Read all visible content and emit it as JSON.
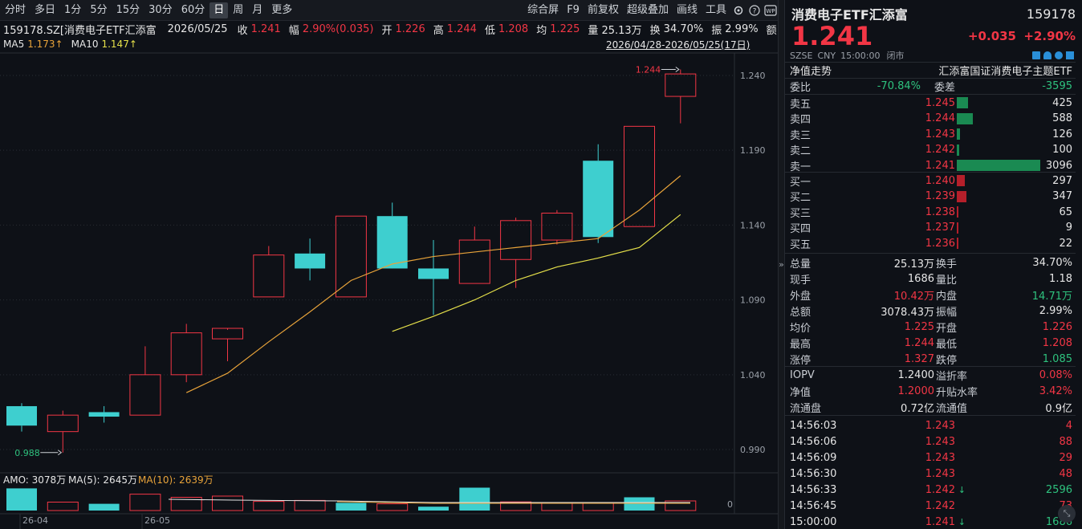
{
  "toolbar": {
    "periods": [
      "分时",
      "多日",
      "1分",
      "5分",
      "15分",
      "30分",
      "60分",
      "日",
      "周",
      "月",
      "更多"
    ],
    "active_period": "日",
    "right_buttons": [
      "综合屏",
      "F9",
      "前复权",
      "超级叠加",
      "画线",
      "工具"
    ],
    "icons": [
      "gear-icon",
      "help-icon",
      "wp-icon"
    ]
  },
  "info": {
    "code": "159178.SZ[消费电子ETF汇添富",
    "date": "2026/05/25",
    "close_label": "收",
    "close": "1.241",
    "chg_label": "幅",
    "chg": "2.90%(0.035)",
    "open_label": "开",
    "open": "1.226",
    "high_label": "高",
    "high": "1.244",
    "low_label": "低",
    "low": "1.208",
    "avg_label": "均",
    "avg": "1.225",
    "vol_label": "量",
    "vol": "25.13万",
    "turn_label": "换",
    "turn": "34.70%",
    "amp_label": "振",
    "amp": "2.99%",
    "amt_label": "额"
  },
  "ma": {
    "ma5_label": "MA5",
    "ma5": "1.173↑",
    "ma10_label": "MA10",
    "ma10": "1.147↑",
    "range": "2026/04/28-2026/05/25(17日)"
  },
  "volume_legend": {
    "amo": "AMO: 3078万",
    "ma5": "MA(5): 2645万",
    "ma10": "MA(10): 2639万",
    "zero": "0"
  },
  "colors": {
    "up": "#f23645",
    "down": "#2ec27e",
    "bear_candle": "#3ecfcf",
    "ma5": "#e8a33a",
    "ma10": "#e5e04a"
  },
  "chart_data": {
    "type": "candlestick",
    "ylim": [
      0.975,
      1.255
    ],
    "yticks": [
      "1.240",
      "1.190",
      "1.140",
      "1.090",
      "1.040",
      "0.990"
    ],
    "xticks": [
      "26-04",
      "26-05"
    ],
    "annotations": {
      "max": "1.244",
      "min": "0.988"
    },
    "candles": [
      {
        "o": 1.019,
        "h": 1.021,
        "l": 1.002,
        "c": 1.006
      },
      {
        "o": 1.002,
        "h": 1.016,
        "l": 0.988,
        "c": 1.013
      },
      {
        "o": 1.015,
        "h": 1.019,
        "l": 1.008,
        "c": 1.012
      },
      {
        "o": 1.013,
        "h": 1.059,
        "l": 1.013,
        "c": 1.04
      },
      {
        "o": 1.04,
        "h": 1.074,
        "l": 1.035,
        "c": 1.068
      },
      {
        "o": 1.064,
        "h": 1.07,
        "l": 1.049,
        "c": 1.071
      },
      {
        "o": 1.092,
        "h": 1.126,
        "l": 1.092,
        "c": 1.12
      },
      {
        "o": 1.121,
        "h": 1.131,
        "l": 1.103,
        "c": 1.111
      },
      {
        "o": 1.092,
        "h": 1.146,
        "l": 1.092,
        "c": 1.146
      },
      {
        "o": 1.146,
        "h": 1.155,
        "l": 1.112,
        "c": 1.111
      },
      {
        "o": 1.111,
        "h": 1.13,
        "l": 1.08,
        "c": 1.104
      },
      {
        "o": 1.101,
        "h": 1.139,
        "l": 1.101,
        "c": 1.13
      },
      {
        "o": 1.117,
        "h": 1.145,
        "l": 1.098,
        "c": 1.143
      },
      {
        "o": 1.13,
        "h": 1.15,
        "l": 1.127,
        "c": 1.148
      },
      {
        "o": 1.183,
        "h": 1.194,
        "l": 1.128,
        "c": 1.132
      },
      {
        "o": 1.139,
        "h": 1.206,
        "l": 1.139,
        "c": 1.206
      },
      {
        "o": 1.226,
        "h": 1.244,
        "l": 1.208,
        "c": 1.241
      }
    ],
    "ma5": [
      null,
      null,
      null,
      null,
      1.028,
      1.041,
      1.062,
      1.082,
      1.103,
      1.114,
      1.119,
      1.122,
      1.125,
      1.128,
      1.131,
      1.15,
      1.173
    ],
    "ma10": [
      null,
      null,
      null,
      null,
      null,
      null,
      null,
      null,
      null,
      1.069,
      1.079,
      1.09,
      1.103,
      1.112,
      1.118,
      1.125,
      1.147
    ],
    "volume_rel": [
      0.92,
      0.35,
      0.28,
      0.68,
      0.55,
      0.6,
      0.38,
      0.42,
      0.32,
      0.28,
      0.16,
      0.95,
      0.36,
      0.3,
      0.3,
      0.55,
      0.4,
      0.5
    ],
    "volume_down": [
      true,
      false,
      true,
      false,
      false,
      false,
      false,
      false,
      true,
      false,
      true,
      true,
      false,
      false,
      false,
      true,
      false,
      false
    ]
  },
  "panel": {
    "name": "消费电子ETF汇添富",
    "code": "159178",
    "price": "1.241",
    "change": "+0.035",
    "change_pct": "+2.90%",
    "market": "SZSE",
    "currency": "CNY",
    "time": "15:00:00",
    "status": "闭市",
    "nav_trend": "净值走势",
    "index_name": "汇添富国证消费电子主题ETF",
    "weibi_label": "委比",
    "weibi": "-70.84%",
    "weicha_label": "委差",
    "weicha": "-3595",
    "asks": [
      {
        "label": "卖五",
        "price": "1.245",
        "vol": "425",
        "ratio": 0.137
      },
      {
        "label": "卖四",
        "price": "1.244",
        "vol": "588",
        "ratio": 0.19
      },
      {
        "label": "卖三",
        "price": "1.243",
        "vol": "126",
        "ratio": 0.041
      },
      {
        "label": "卖二",
        "price": "1.242",
        "vol": "100",
        "ratio": 0.032
      },
      {
        "label": "卖一",
        "price": "1.241",
        "vol": "3096",
        "ratio": 1.0
      }
    ],
    "bids": [
      {
        "label": "买一",
        "price": "1.240",
        "vol": "297",
        "ratio": 0.096
      },
      {
        "label": "买二",
        "price": "1.239",
        "vol": "347",
        "ratio": 0.112
      },
      {
        "label": "买三",
        "price": "1.238",
        "vol": "65",
        "ratio": 0.021
      },
      {
        "label": "买四",
        "price": "1.237",
        "vol": "9",
        "ratio": 0.003
      },
      {
        "label": "买五",
        "price": "1.236",
        "vol": "22",
        "ratio": 0.007
      }
    ],
    "stats": [
      [
        {
          "l": "总量",
          "v": "25.13万",
          "c": "white"
        },
        {
          "l": "换手",
          "v": "34.70%",
          "c": "white"
        }
      ],
      [
        {
          "l": "现手",
          "v": "1686",
          "c": "white"
        },
        {
          "l": "量比",
          "v": "1.18",
          "c": "white"
        }
      ],
      [
        {
          "l": "外盘",
          "v": "10.42万",
          "c": "up"
        },
        {
          "l": "内盘",
          "v": "14.71万",
          "c": "down"
        }
      ],
      [
        {
          "l": "总额",
          "v": "3078.43万",
          "c": "white"
        },
        {
          "l": "振幅",
          "v": "2.99%",
          "c": "white"
        }
      ],
      [
        {
          "l": "均价",
          "v": "1.225",
          "c": "up"
        },
        {
          "l": "开盘",
          "v": "1.226",
          "c": "up"
        }
      ],
      [
        {
          "l": "最高",
          "v": "1.244",
          "c": "up"
        },
        {
          "l": "最低",
          "v": "1.208",
          "c": "up"
        }
      ],
      [
        {
          "l": "涨停",
          "v": "1.327",
          "c": "up"
        },
        {
          "l": "跌停",
          "v": "1.085",
          "c": "down"
        }
      ]
    ],
    "etf_stats": [
      [
        {
          "l": "IOPV",
          "v": "1.2400",
          "c": "white"
        },
        {
          "l": "溢折率",
          "v": "0.08%",
          "c": "up"
        }
      ],
      [
        {
          "l": "净值",
          "v": "1.2000",
          "c": "up"
        },
        {
          "l": "升贴水率",
          "v": "3.42%",
          "c": "up"
        }
      ],
      [
        {
          "l": "流通盘",
          "v": "0.72亿",
          "c": "white"
        },
        {
          "l": "流通值",
          "v": "0.9亿",
          "c": "white"
        }
      ]
    ],
    "ticks": [
      {
        "t": "14:56:03",
        "p": "1.243",
        "v": "4",
        "pc": "up",
        "vc": "up",
        "arrow": ""
      },
      {
        "t": "14:56:06",
        "p": "1.243",
        "v": "88",
        "pc": "up",
        "vc": "up",
        "arrow": ""
      },
      {
        "t": "14:56:09",
        "p": "1.243",
        "v": "29",
        "pc": "up",
        "vc": "up",
        "arrow": ""
      },
      {
        "t": "14:56:30",
        "p": "1.243",
        "v": "48",
        "pc": "up",
        "vc": "up",
        "arrow": ""
      },
      {
        "t": "14:56:33",
        "p": "1.242",
        "v": "2596",
        "pc": "up",
        "vc": "down",
        "arrow": "↓"
      },
      {
        "t": "14:56:45",
        "p": "1.242",
        "v": "73",
        "pc": "up",
        "vc": "up",
        "arrow": ""
      },
      {
        "t": "15:00:00",
        "p": "1.241",
        "v": "1686",
        "pc": "up",
        "vc": "down",
        "arrow": "↓"
      }
    ]
  }
}
